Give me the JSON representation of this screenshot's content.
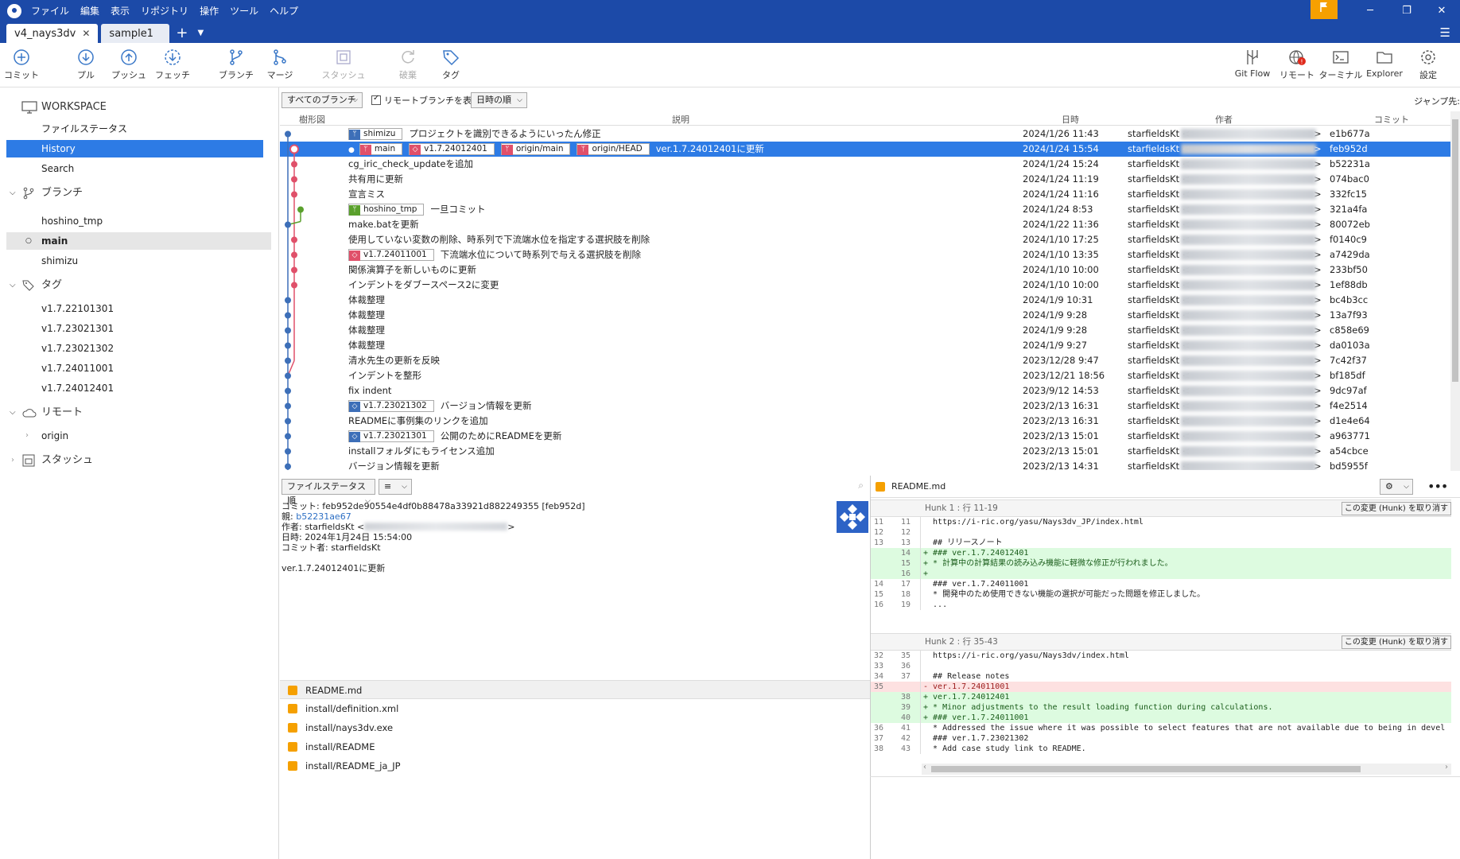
{
  "menu": [
    "ファイル",
    "編集",
    "表示",
    "リポジトリ",
    "操作",
    "ツール",
    "ヘルプ"
  ],
  "tabs": [
    {
      "label": "v4_nays3dv",
      "active": true
    },
    {
      "label": "sample1",
      "active": false
    }
  ],
  "toolbar": {
    "commit": "コミット",
    "pull": "プル",
    "push": "プッシュ",
    "fetch": "フェッチ",
    "branch": "ブランチ",
    "merge": "マージ",
    "stash": "スタッシュ",
    "discard": "破棄",
    "tag": "タグ",
    "gitflow": "Git Flow",
    "remote": "リモート",
    "terminal": "ターミナル",
    "explorer": "Explorer",
    "settings": "設定"
  },
  "sidebar": {
    "workspace": "WORKSPACE",
    "file_status": "ファイルステータス",
    "history": "History",
    "search": "Search",
    "branches_head": "ブランチ",
    "branches": [
      "hoshino_tmp",
      "main",
      "shimizu"
    ],
    "tags_head": "タグ",
    "tags": [
      "v1.7.22101301",
      "v1.7.23021301",
      "v1.7.23021302",
      "v1.7.24011001",
      "v1.7.24012401"
    ],
    "remotes_head": "リモート",
    "remotes": [
      "origin"
    ],
    "stash_head": "スタッシュ"
  },
  "filter": {
    "branches": "すべてのブランチ",
    "show_remote": "リモートブランチを表示",
    "order": "日時の順",
    "jump": "ジャンプ先:"
  },
  "columns": {
    "graph": "樹形図",
    "desc": "説明",
    "date": "日時",
    "author": "作者",
    "commit": "コミット"
  },
  "commits": [
    {
      "badges": [
        {
          "t": "branch",
          "label": "shimizu"
        }
      ],
      "msg": "プロジェクトを識別できるようにいったん修正",
      "date": "2024/1/26 11:43",
      "author": "starfieldsKt <",
      "hash": "e1b677a"
    },
    {
      "badges": [
        {
          "t": "head",
          "label": "main"
        },
        {
          "t": "tag",
          "label": "v1.7.24012401"
        },
        {
          "t": "remote",
          "label": "origin/main"
        },
        {
          "t": "remote",
          "label": "origin/HEAD"
        }
      ],
      "msg": "ver.1.7.24012401に更新",
      "date": "2024/1/24 15:54",
      "author": "starfieldsKt <",
      "hash": "feb952d",
      "selected": true
    },
    {
      "badges": [],
      "msg": "cg_iric_check_updateを追加",
      "date": "2024/1/24 15:24",
      "author": "starfieldsKt <",
      "hash": "b52231a"
    },
    {
      "badges": [],
      "msg": "共有用に更新",
      "date": "2024/1/24 11:19",
      "author": "starfieldsKt <",
      "hash": "074bac0"
    },
    {
      "badges": [],
      "msg": "宣言ミス",
      "date": "2024/1/24 11:16",
      "author": "starfieldsKt <",
      "hash": "332fc15"
    },
    {
      "badges": [
        {
          "t": "green",
          "label": "hoshino_tmp"
        }
      ],
      "msg": "一旦コミット",
      "date": "2024/1/24 8:53",
      "author": "starfieldsKt <",
      "hash": "321a4fa"
    },
    {
      "badges": [],
      "msg": "make.batを更新",
      "date": "2024/1/22 11:36",
      "author": "starfieldsKt <",
      "hash": "80072eb"
    },
    {
      "badges": [],
      "msg": "使用していない変数の削除、時系列で下流端水位を指定する選択肢を削除",
      "date": "2024/1/10 17:25",
      "author": "starfieldsKt <",
      "hash": "f0140c9"
    },
    {
      "badges": [
        {
          "t": "tag",
          "label": "v1.7.24011001"
        }
      ],
      "msg": "下流端水位について時系列で与える選択肢を削除",
      "date": "2024/1/10 13:35",
      "author": "starfieldsKt <",
      "hash": "a7429da"
    },
    {
      "badges": [],
      "msg": "関係演算子を新しいものに更新",
      "date": "2024/1/10 10:00",
      "author": "starfieldsKt <",
      "hash": "233bf50"
    },
    {
      "badges": [],
      "msg": "インデントをダブースペース2に変更",
      "date": "2024/1/10 10:00",
      "author": "starfieldsKt <",
      "hash": "1ef88db"
    },
    {
      "badges": [],
      "msg": "体裁整理",
      "date": "2024/1/9 10:31",
      "author": "starfieldsKt <",
      "hash": "bc4b3cc"
    },
    {
      "badges": [],
      "msg": "体裁整理",
      "date": "2024/1/9 9:28",
      "author": "starfieldsKt <",
      "hash": "13a7f93"
    },
    {
      "badges": [],
      "msg": "体裁整理",
      "date": "2024/1/9 9:28",
      "author": "starfieldsKt <",
      "hash": "c858e69"
    },
    {
      "badges": [],
      "msg": "体裁整理",
      "date": "2024/1/9 9:27",
      "author": "starfieldsKt <",
      "hash": "da0103a"
    },
    {
      "badges": [],
      "msg": "清水先生の更新を反映",
      "date": "2023/12/28 9:47",
      "author": "starfieldsKt <",
      "hash": "7c42f37"
    },
    {
      "badges": [],
      "msg": "インデントを整形",
      "date": "2023/12/21 18:56",
      "author": "starfieldsKt <",
      "hash": "bf185df"
    },
    {
      "badges": [],
      "msg": "fix indent",
      "date": "2023/9/12 14:53",
      "author": "starfieldsKt <",
      "hash": "9dc97af"
    },
    {
      "badges": [
        {
          "t": "tagblue",
          "label": "v1.7.23021302"
        }
      ],
      "msg": "バージョン情報を更新",
      "date": "2023/2/13 16:31",
      "author": "starfieldsKt <",
      "hash": "f4e2514"
    },
    {
      "badges": [],
      "msg": "READMEに事例集のリンクを追加",
      "date": "2023/2/13 16:31",
      "author": "starfieldsKt <",
      "hash": "d1e4e64"
    },
    {
      "badges": [
        {
          "t": "tagblue",
          "label": "v1.7.23021301"
        }
      ],
      "msg": "公開のためにREADMEを更新",
      "date": "2023/2/13 15:01",
      "author": "starfieldsKt <",
      "hash": "a963771"
    },
    {
      "badges": [],
      "msg": "installフォルダにもライセンス追加",
      "date": "2023/2/13 15:01",
      "author": "starfieldsKt <",
      "hash": "a54cbce"
    },
    {
      "badges": [],
      "msg": "バージョン情報を更新",
      "date": "2023/2/13 14:31",
      "author": "starfieldsKt <",
      "hash": "bd5955f"
    }
  ],
  "details": {
    "sort": "ファイルステータス順",
    "commit_line": "コミット: feb952de90554e4df0b88478a33921d882249355 [feb952d]",
    "parent_label": "親:",
    "parent": "b52231ae67",
    "author_line": "作者: starfieldsKt <",
    "author_end": ">",
    "date_line": "日時: 2024年1月24日 15:54:00",
    "committer_line": "コミット者: starfieldsKt",
    "message": "ver.1.7.24012401に更新",
    "files": [
      "README.md",
      "install/definition.xml",
      "install/nays3dv.exe",
      "install/README",
      "install/README_ja_JP"
    ]
  },
  "diff": {
    "file": "README.md",
    "discard_label": "この変更 (Hunk) を取り消す",
    "hunks": [
      {
        "head": "Hunk 1 : 行 11-19",
        "lines": [
          {
            "o": "11",
            "n": "11",
            "t": "ctx",
            "c": "  https://i-ric.org/yasu/Nays3dv_JP/index.html"
          },
          {
            "o": "12",
            "n": "12",
            "t": "ctx",
            "c": "  "
          },
          {
            "o": "13",
            "n": "13",
            "t": "ctx",
            "c": "  ## リリースノート"
          },
          {
            "o": "",
            "n": "14",
            "t": "add",
            "c": "+ ### ver.1.7.24012401"
          },
          {
            "o": "",
            "n": "15",
            "t": "add",
            "c": "+ * 計算中の計算結果の読み込み機能に軽微な修正が行われました。"
          },
          {
            "o": "",
            "n": "16",
            "t": "add",
            "c": "+ "
          },
          {
            "o": "14",
            "n": "17",
            "t": "ctx",
            "c": "  ### ver.1.7.24011001"
          },
          {
            "o": "15",
            "n": "18",
            "t": "ctx",
            "c": "  * 開発中のため使用できない機能の選択が可能だった問題を修正しました。"
          },
          {
            "o": "16",
            "n": "19",
            "t": "ctx",
            "c": "  ..."
          }
        ]
      },
      {
        "head": "Hunk 2 : 行 35-43",
        "lines": [
          {
            "o": "32",
            "n": "35",
            "t": "ctx",
            "c": "  https://i-ric.org/yasu/Nays3dv/index.html"
          },
          {
            "o": "33",
            "n": "36",
            "t": "ctx",
            "c": "  "
          },
          {
            "o": "34",
            "n": "37",
            "t": "ctx",
            "c": "  ## Release notes"
          },
          {
            "o": "35",
            "n": "",
            "t": "del",
            "c": "- ver.1.7.24011001"
          },
          {
            "o": "",
            "n": "38",
            "t": "add",
            "c": "+ ver.1.7.24012401"
          },
          {
            "o": "",
            "n": "39",
            "t": "add",
            "c": "+ * Minor adjustments to the result loading function during calculations."
          },
          {
            "o": "",
            "n": "40",
            "t": "add",
            "c": "+ ### ver.1.7.24011001"
          },
          {
            "o": "36",
            "n": "41",
            "t": "ctx",
            "c": "  * Addressed the issue where it was possible to select features that are not available due to being in devel"
          },
          {
            "o": "37",
            "n": "42",
            "t": "ctx",
            "c": "  ### ver.1.7.23021302"
          },
          {
            "o": "38",
            "n": "43",
            "t": "ctx",
            "c": "  * Add case study link to README."
          }
        ]
      }
    ]
  },
  "colors": {
    "accent": "#2d7be5",
    "titlebar": "#1c4aa8",
    "branch": "#3d6fb8",
    "tag": "#e0506a",
    "green": "#5aa02c"
  }
}
